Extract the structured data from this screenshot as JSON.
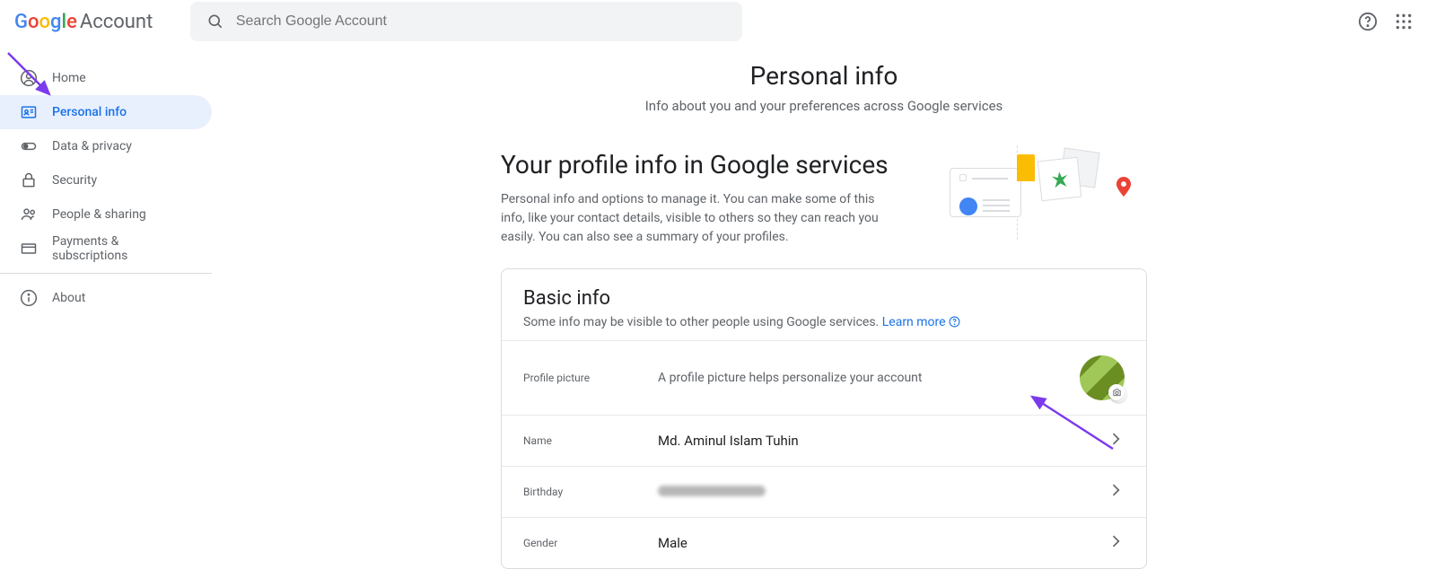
{
  "header": {
    "logo_account": "Account",
    "search_placeholder": "Search Google Account"
  },
  "sidebar": {
    "items": [
      {
        "label": "Home",
        "active": false
      },
      {
        "label": "Personal info",
        "active": true
      },
      {
        "label": "Data & privacy",
        "active": false
      },
      {
        "label": "Security",
        "active": false
      },
      {
        "label": "People & sharing",
        "active": false
      },
      {
        "label": "Payments & subscriptions",
        "active": false
      },
      {
        "label": "About",
        "active": false
      }
    ]
  },
  "page": {
    "title": "Personal info",
    "subtitle": "Info about you and your preferences across Google services"
  },
  "profile_section": {
    "title": "Your profile info in Google services",
    "desc": "Personal info and options to manage it. You can make some of this info, like your contact details, visible to others so they can reach you easily. You can also see a summary of your profiles."
  },
  "basic_info": {
    "title": "Basic info",
    "desc": "Some info may be visible to other people using Google services. ",
    "learn_more": "Learn more",
    "rows": {
      "picture": {
        "label": "Profile picture",
        "desc": "A profile picture helps personalize your account"
      },
      "name": {
        "label": "Name",
        "value": "Md. Aminul Islam Tuhin"
      },
      "birthday": {
        "label": "Birthday",
        "value": ""
      },
      "gender": {
        "label": "Gender",
        "value": "Male"
      }
    }
  }
}
